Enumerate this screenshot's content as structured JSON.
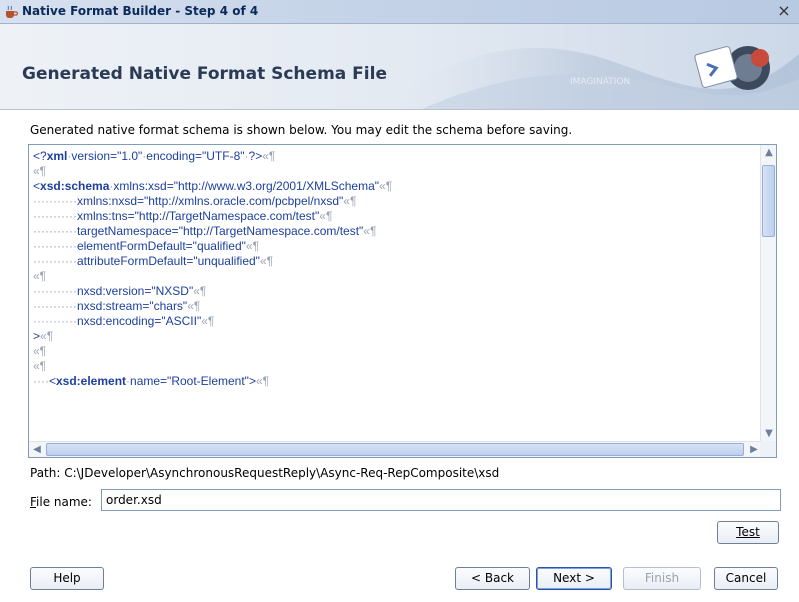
{
  "window": {
    "title": "Native Format Builder - Step 4 of 4",
    "close_glyph": "×"
  },
  "header": {
    "title": "Generated Native Format Schema File",
    "watermark": "IMAGINATION"
  },
  "description": "Generated native format schema is shown below. You may edit the schema before saving.",
  "code_lines": [
    [
      {
        "t": "<?",
        "c": "punct"
      },
      {
        "t": "xml",
        "c": "kw"
      },
      {
        "t": "·",
        "c": "dots"
      },
      {
        "t": "version=\"1.0\"",
        "c": "val"
      },
      {
        "t": "·",
        "c": "dots"
      },
      {
        "t": "encoding=\"UTF-8\"",
        "c": "val"
      },
      {
        "t": "·",
        "c": "dots"
      },
      {
        "t": "?>",
        "c": "punct"
      },
      {
        "t": "«¶",
        "c": "pil"
      }
    ],
    [
      {
        "t": "«¶",
        "c": "pil"
      }
    ],
    [
      {
        "t": "<",
        "c": "punct"
      },
      {
        "t": "xsd:schema",
        "c": "kw"
      },
      {
        "t": "·",
        "c": "dots"
      },
      {
        "t": "xmlns:xsd=\"http://www.w3.org/2001/XMLSchema\"",
        "c": "attr"
      },
      {
        "t": "«¶",
        "c": "pil"
      }
    ],
    [
      {
        "t": "···········",
        "c": "dots"
      },
      {
        "t": "xmlns:nxsd=\"http://xmlns.oracle.com/pcbpel/nxsd\"",
        "c": "attr"
      },
      {
        "t": "«¶",
        "c": "pil"
      }
    ],
    [
      {
        "t": "···········",
        "c": "dots"
      },
      {
        "t": "xmlns:tns=\"http://TargetNamespace.com/test\"",
        "c": "attr"
      },
      {
        "t": "«¶",
        "c": "pil"
      }
    ],
    [
      {
        "t": "···········",
        "c": "dots"
      },
      {
        "t": "targetNamespace=\"http://TargetNamespace.com/test\"",
        "c": "attr"
      },
      {
        "t": "«¶",
        "c": "pil"
      }
    ],
    [
      {
        "t": "···········",
        "c": "dots"
      },
      {
        "t": "elementFormDefault=\"qualified\"",
        "c": "attr"
      },
      {
        "t": "«¶",
        "c": "pil"
      }
    ],
    [
      {
        "t": "···········",
        "c": "dots"
      },
      {
        "t": "attributeFormDefault=\"unqualified\"",
        "c": "attr"
      },
      {
        "t": "«¶",
        "c": "pil"
      }
    ],
    [
      {
        "t": "«¶",
        "c": "pil"
      }
    ],
    [
      {
        "t": "···········",
        "c": "dots"
      },
      {
        "t": "nxsd:version=\"NXSD\"",
        "c": "attr"
      },
      {
        "t": "«¶",
        "c": "pil"
      }
    ],
    [
      {
        "t": "···········",
        "c": "dots"
      },
      {
        "t": "nxsd:stream=\"chars\"",
        "c": "attr"
      },
      {
        "t": "«¶",
        "c": "pil"
      }
    ],
    [
      {
        "t": "···········",
        "c": "dots"
      },
      {
        "t": "nxsd:encoding=\"ASCII\"",
        "c": "attr"
      },
      {
        "t": "«¶",
        "c": "pil"
      }
    ],
    [
      {
        "t": ">",
        "c": "punct"
      },
      {
        "t": "«¶",
        "c": "pil"
      }
    ],
    [
      {
        "t": "«¶",
        "c": "pil"
      }
    ],
    [
      {
        "t": "«¶",
        "c": "pil"
      }
    ],
    [
      {
        "t": "····",
        "c": "dots"
      },
      {
        "t": "<",
        "c": "punct"
      },
      {
        "t": "xsd:element",
        "c": "kw"
      },
      {
        "t": "·",
        "c": "dots"
      },
      {
        "t": "name=\"Root-Element\"",
        "c": "attr"
      },
      {
        "t": ">",
        "c": "punct"
      },
      {
        "t": "«¶",
        "c": "pil"
      }
    ]
  ],
  "scroll": {
    "up": "▲",
    "down": "▼",
    "left": "◀",
    "right": "▶"
  },
  "path_label": "Path: C:\\JDeveloper\\AsynchronousRequestReply\\Async-Req-RepComposite\\xsd",
  "file_name": {
    "label_prefix": "",
    "label_mnemonic": "F",
    "label_rest": "ile name:",
    "value": "order.xsd"
  },
  "buttons": {
    "test": "Test",
    "help": "Help",
    "back": "< Back",
    "next": "Next >",
    "finish": "Finish",
    "cancel": "Cancel"
  },
  "colors": {
    "accent": "#1d3f9e",
    "title_text": "#2b3a55"
  },
  "icons": {
    "app": "coffee-cup-icon",
    "header": "wizard-graphic-icon"
  }
}
